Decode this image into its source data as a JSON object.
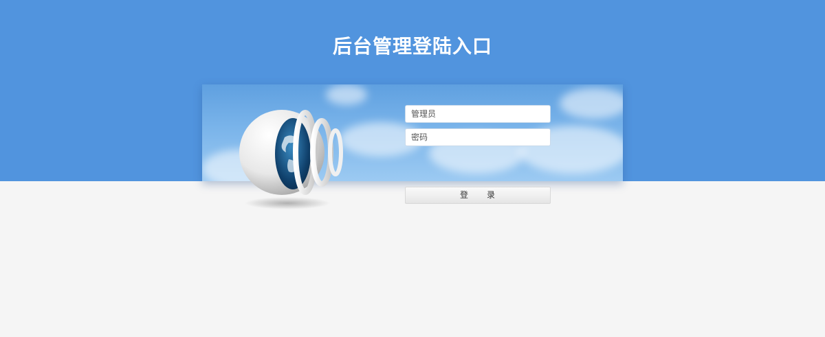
{
  "header": {
    "title": "后台管理登陆入口"
  },
  "login": {
    "username_placeholder": "管理员",
    "password_placeholder": "密码",
    "submit_label": "登　　录"
  },
  "colors": {
    "header_background": "#5194de",
    "page_background": "#f5f5f5",
    "title_text": "#ffffff"
  },
  "icons": {
    "logo": "globe-logo-icon"
  }
}
